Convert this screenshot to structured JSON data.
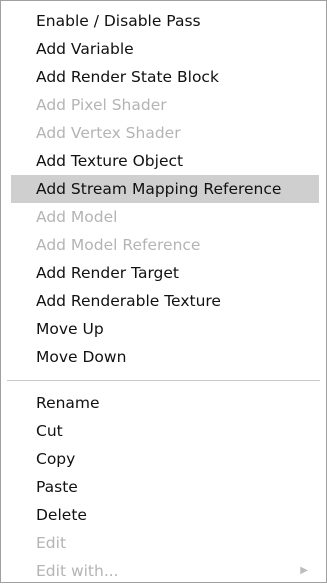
{
  "menu": {
    "group1": [
      {
        "label": "Enable / Disable Pass",
        "enabled": true
      },
      {
        "label": "Add Variable",
        "enabled": true
      },
      {
        "label": "Add Render State Block",
        "enabled": true
      },
      {
        "label": "Add Pixel Shader",
        "enabled": false
      },
      {
        "label": "Add Vertex Shader",
        "enabled": false
      },
      {
        "label": "Add Texture Object",
        "enabled": true
      },
      {
        "label": "Add Stream Mapping Reference",
        "enabled": true,
        "highlighted": true
      },
      {
        "label": "Add Model",
        "enabled": false
      },
      {
        "label": "Add Model Reference",
        "enabled": false
      },
      {
        "label": "Add Render Target",
        "enabled": true
      },
      {
        "label": "Add Renderable Texture",
        "enabled": true
      },
      {
        "label": "Move Up",
        "enabled": true
      },
      {
        "label": "Move Down",
        "enabled": true
      }
    ],
    "group2": [
      {
        "label": "Rename",
        "enabled": true
      },
      {
        "label": "Cut",
        "enabled": true
      },
      {
        "label": "Copy",
        "enabled": true
      },
      {
        "label": "Paste",
        "enabled": true
      },
      {
        "label": "Delete",
        "enabled": true
      },
      {
        "label": "Edit",
        "enabled": false
      },
      {
        "label": "Edit with...",
        "enabled": false,
        "submenu": true,
        "submenu_icon": "triangle-right-icon"
      }
    ]
  },
  "colors": {
    "highlight_background": "#cfcfcf",
    "disabled_text": "#b4b4b4",
    "enabled_text": "#111111",
    "border": "#a0a0a0",
    "separator": "#c8c8c8"
  }
}
